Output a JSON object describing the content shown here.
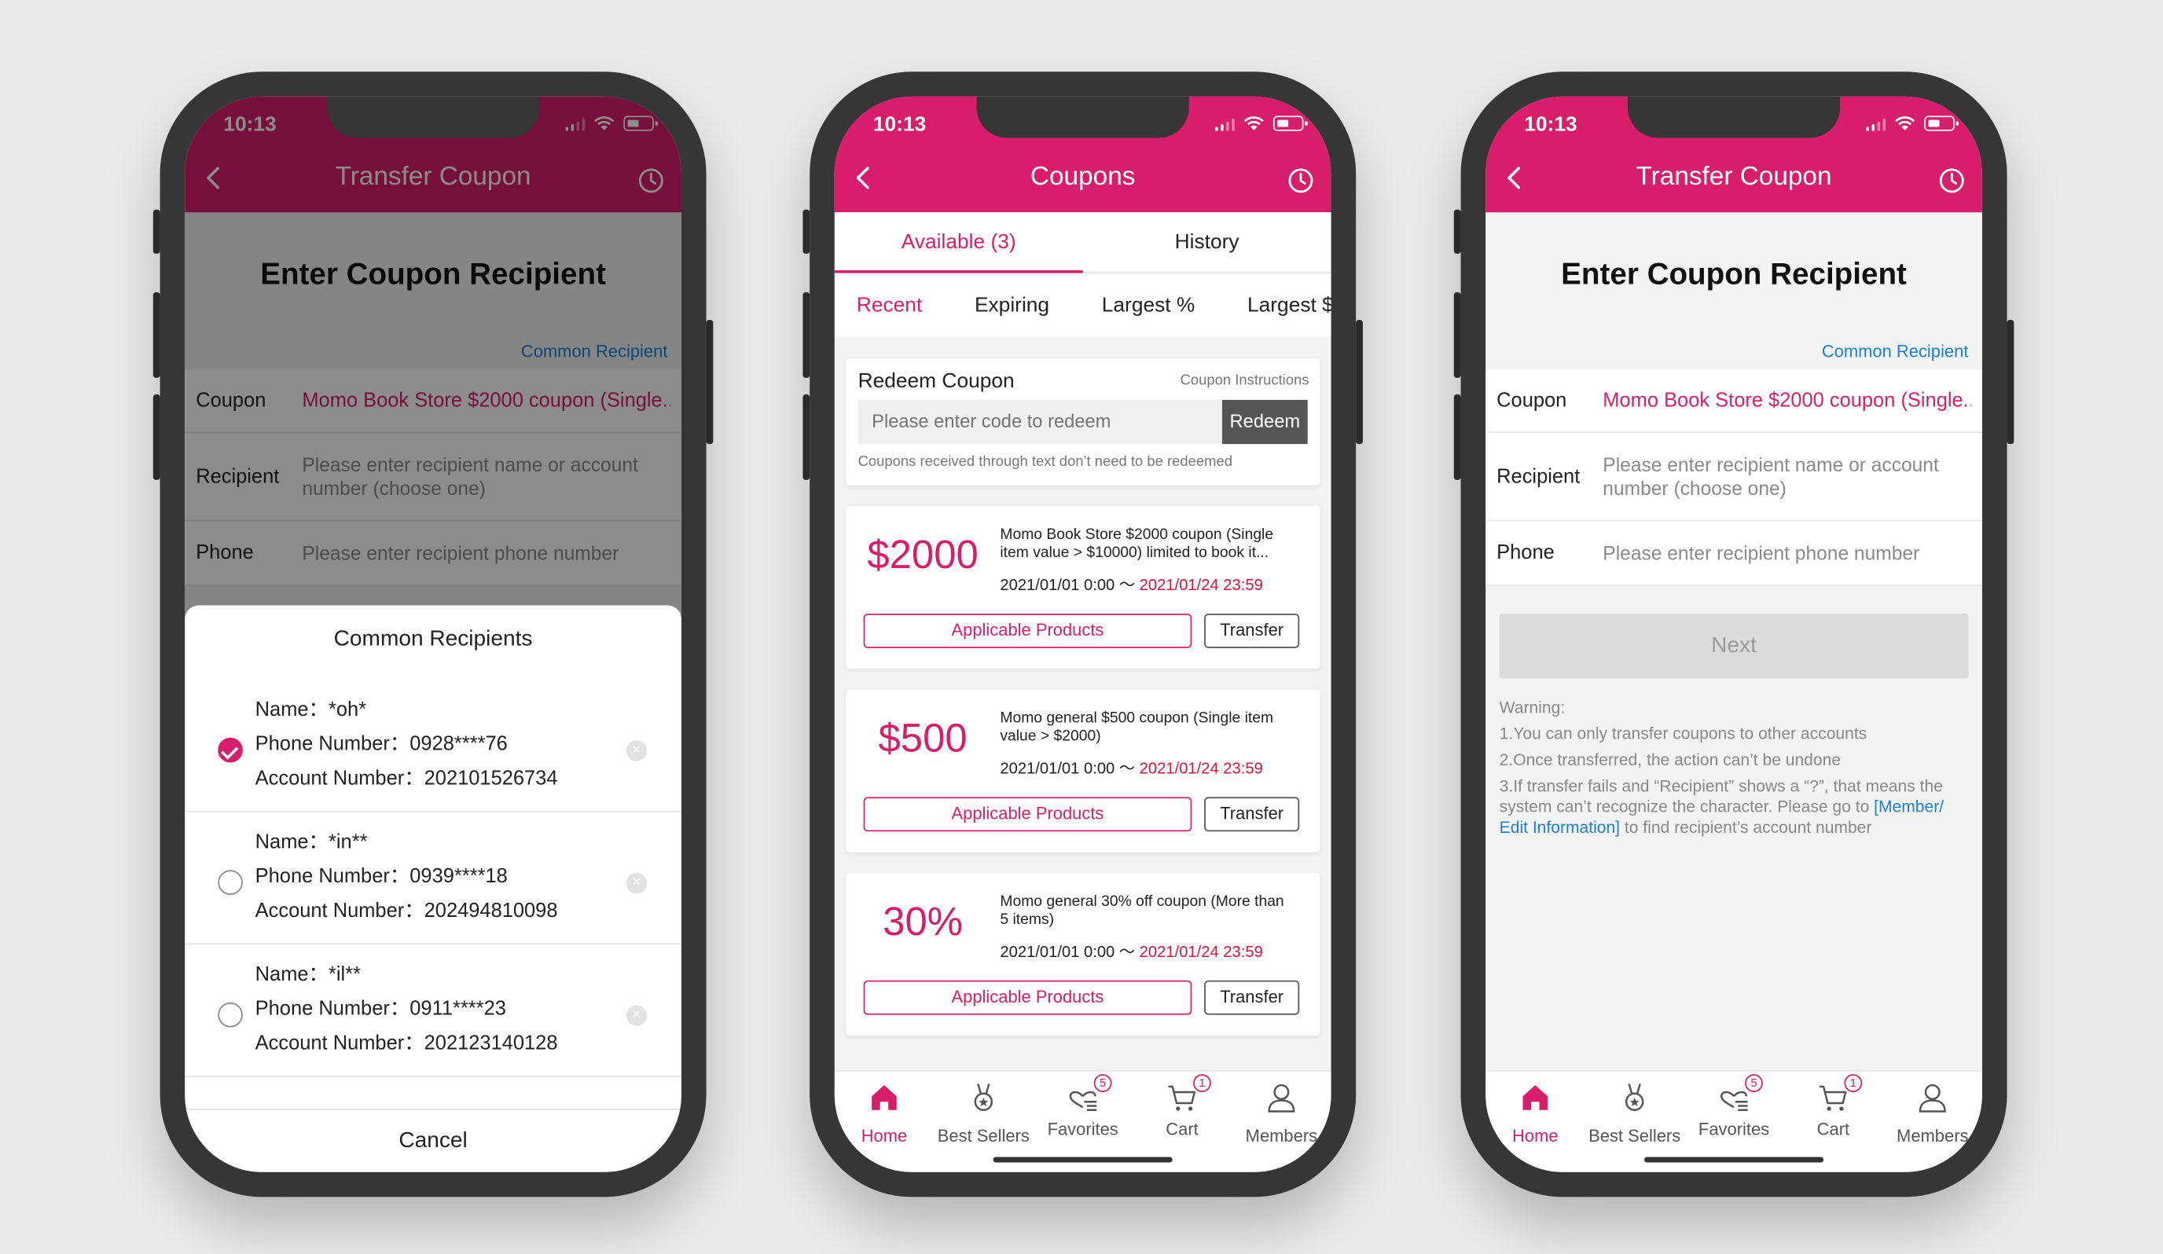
{
  "status_time": "10:13",
  "transfer": {
    "nav_title": "Transfer Coupon",
    "heading": "Enter Coupon Recipient",
    "common_link": "Common Recipient",
    "coupon_label": "Coupon",
    "coupon_value": "Momo Book Store $2000 coupon (Single...",
    "recipient_label": "Recipient",
    "recipient_placeholder": "Please enter recipient name or account number (choose one)",
    "phone_label": "Phone",
    "phone_placeholder": "Please enter recipient phone number",
    "next_label": "Next",
    "warning_title": "Warning:",
    "warning_1": "1.You can only transfer coupons to other accounts",
    "warning_2": "2.Once transferred, the action can’t be undone",
    "warning_3a": "3.If transfer fails and “Recipient” shows a “?”, that means the system can’t recognize the character. Please go to ",
    "warning_3_link": "[Member/ Edit Information]",
    "warning_3b": " to find recipient’s account number"
  },
  "common_sheet": {
    "title": "Common Recipients",
    "recipients": [
      {
        "name": "Name：*oh*",
        "phone": "Phone Number：0928****76",
        "account": "Account Number：202101526734",
        "selected": true
      },
      {
        "name": "Name：*in**",
        "phone": "Phone Number：0939****18",
        "account": "Account Number：202494810098",
        "selected": false
      },
      {
        "name": "Name：*il**",
        "phone": "Phone Number：0911****23",
        "account": "Account Number：202123140128",
        "selected": false
      }
    ],
    "cancel_label": "Cancel"
  },
  "coupons_page": {
    "nav_title": "Coupons",
    "tabs": [
      "Available (3)",
      "History"
    ],
    "filters": [
      "Recent",
      "Expiring",
      "Largest %",
      "Largest $"
    ],
    "redeem_title": "Redeem Coupon",
    "redeem_instructions": "Coupon Instructions",
    "redeem_placeholder": "Please enter code to redeem",
    "redeem_button": "Redeem",
    "redeem_note": "Coupons received through text don’t need to be redeemed",
    "applicable_label": "Applicable Products",
    "transfer_label": "Transfer",
    "coupons": [
      {
        "amount": "$2000",
        "desc": "Momo Book Store $2000 coupon (Single item value > $10000) limited to book it...",
        "start": "2021/01/01 0:00 〜 ",
        "end": "2021/01/24 23:59"
      },
      {
        "amount": "$500",
        "desc": "Momo general $500 coupon (Single item value > $2000)",
        "start": "2021/01/01 0:00 〜 ",
        "end": "2021/01/24 23:59"
      },
      {
        "amount": "30%",
        "desc": "Momo general 30% off coupon (More than 5 items)",
        "start": "2021/01/01 0:00 〜 ",
        "end": "2021/01/24 23:59"
      }
    ]
  },
  "bottom_nav": {
    "home": "Home",
    "best_sellers": "Best Sellers",
    "favorites": "Favorites",
    "cart": "Cart",
    "members": "Members",
    "favorites_badge": "5",
    "cart_badge": "1"
  },
  "colors": {
    "brand": "#d81e6a",
    "link": "#1a7fd6",
    "expiry": "#e0103c"
  }
}
